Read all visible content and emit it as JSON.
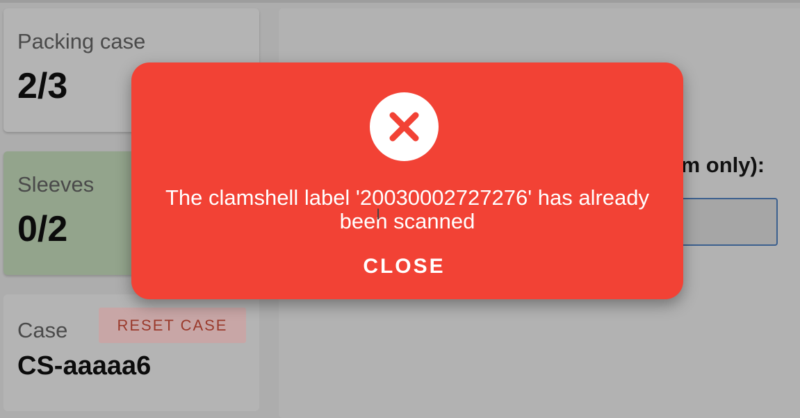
{
  "packing": {
    "title": "Packing case",
    "value": "2/3"
  },
  "sleeves": {
    "title": "Sleeves",
    "value": "0/2"
  },
  "case": {
    "title": "Case",
    "reset_label": "RESET CASE",
    "id": "CS-aaaaa6"
  },
  "scan": {
    "label_visible": "ttom only):",
    "value": ""
  },
  "dialog": {
    "icon": "error-x-icon",
    "message": "The clamshell label '20030002727276' has already been scanned",
    "close_label": "CLOSE"
  },
  "colors": {
    "dialog_bg": "#f24235",
    "sleeves_card": "#93a48c",
    "reset_text": "#9a3a2c"
  }
}
